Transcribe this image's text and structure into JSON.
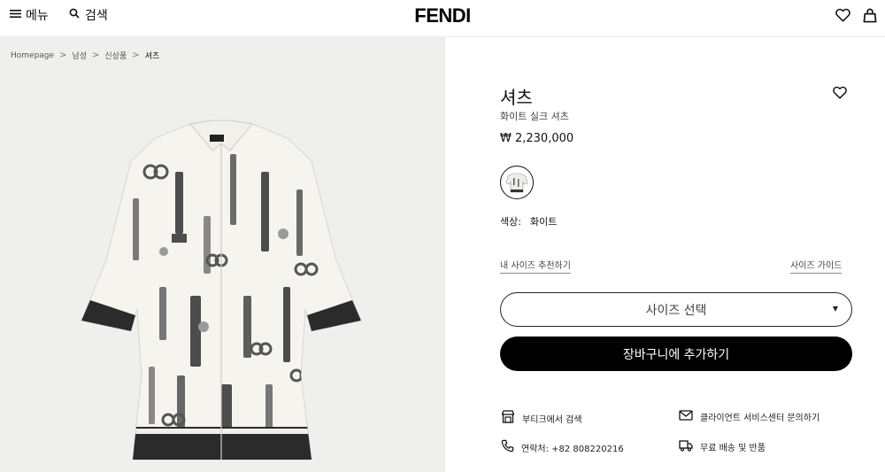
{
  "header": {
    "menu_label": "메뉴",
    "search_label": "검색",
    "logo": "FENDI",
    "icons": [
      "hamburger-icon",
      "search-icon",
      "heart-icon",
      "bag-icon"
    ]
  },
  "breadcrumb": {
    "items": [
      "Homepage",
      "남성",
      "신상품",
      "셔츠"
    ],
    "separator": ">"
  },
  "product": {
    "title": "셔츠",
    "subtitle": "화이트 실크 셔츠",
    "price": "₩ 2,230,000",
    "color_label": "색상:",
    "color_value": "화이트"
  },
  "links": {
    "size_recommend": "내 사이즈 추천하기",
    "size_guide": "사이즈 가이드"
  },
  "size_select": {
    "placeholder": "사이즈 선택"
  },
  "cart": {
    "label": "장바구니에 추가하기"
  },
  "services": {
    "boutique": "부티크에서 검색",
    "contact_service": "클라이언트 서비스센터 문의하기",
    "phone": "연락처: +82 808220216",
    "shipping": "무료 배송 및 반품"
  },
  "colors": {
    "accent": "#000000",
    "image_bg": "#efefed"
  }
}
